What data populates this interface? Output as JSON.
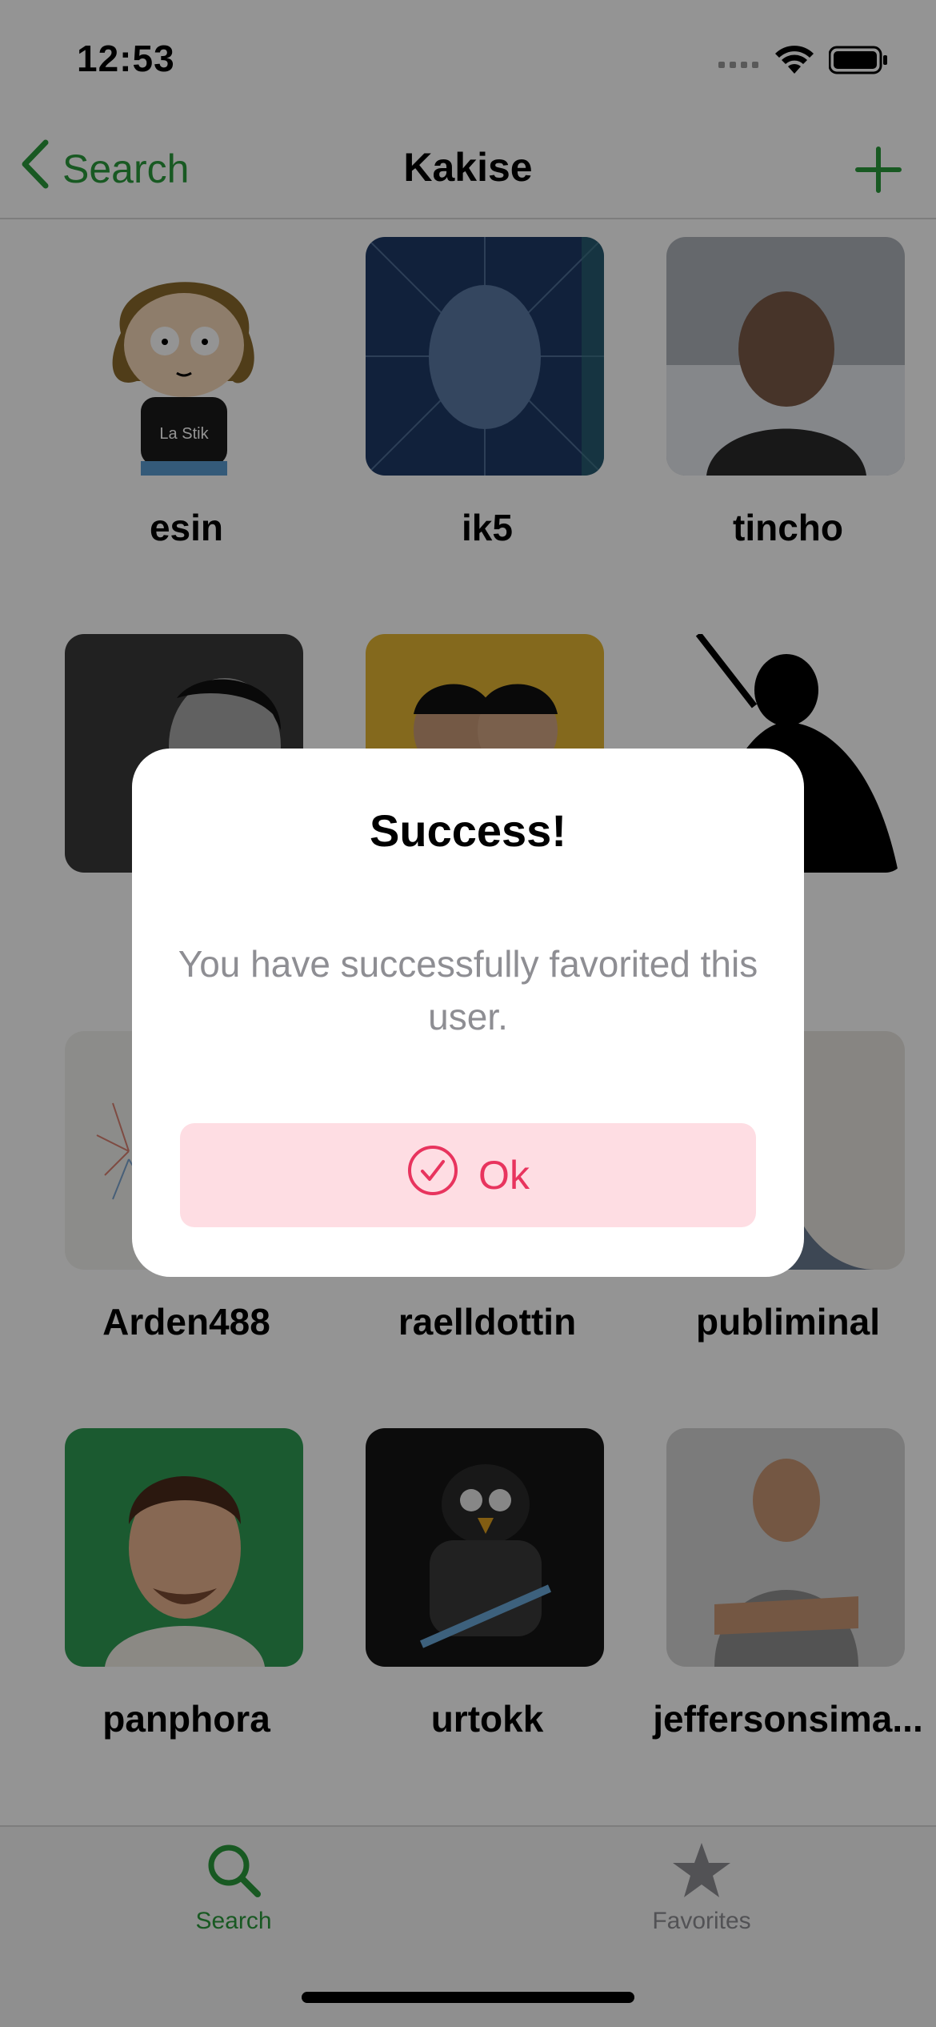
{
  "status_bar": {
    "time": "12:53"
  },
  "nav": {
    "back_label": "Search",
    "title": "Kakise"
  },
  "users": [
    {
      "name": "esin",
      "bg": "#ffffff"
    },
    {
      "name": "ik5",
      "bg": "#1e3a66"
    },
    {
      "name": "tincho",
      "bg": "#8b8e95"
    },
    {
      "name": "",
      "bg": "#3a3a3a"
    },
    {
      "name": "",
      "bg": "#e3b632"
    },
    {
      "name": "",
      "bg": "#ffffff"
    },
    {
      "name": "Arden488",
      "bg": "#f2f2ee"
    },
    {
      "name": "raelldottin",
      "bg": "#ffffff"
    },
    {
      "name": "publiminal",
      "bg": "#d9cbbb"
    },
    {
      "name": "panphora",
      "bg": "#2f9c54"
    },
    {
      "name": "urtokk",
      "bg": "#151515"
    },
    {
      "name": "jeffersonsima...",
      "bg": "#d4d4d4"
    }
  ],
  "tabs": [
    {
      "label": "Search",
      "icon": "search-icon",
      "active": true
    },
    {
      "label": "Favorites",
      "icon": "star-icon",
      "active": false
    }
  ],
  "alert": {
    "title": "Success!",
    "message": "You have successfully favorited this user.",
    "ok_label": "Ok"
  },
  "colors": {
    "accent_green": "#2a9a3c",
    "ok_pink": "#e8345e",
    "ok_bg": "#fedde3"
  }
}
